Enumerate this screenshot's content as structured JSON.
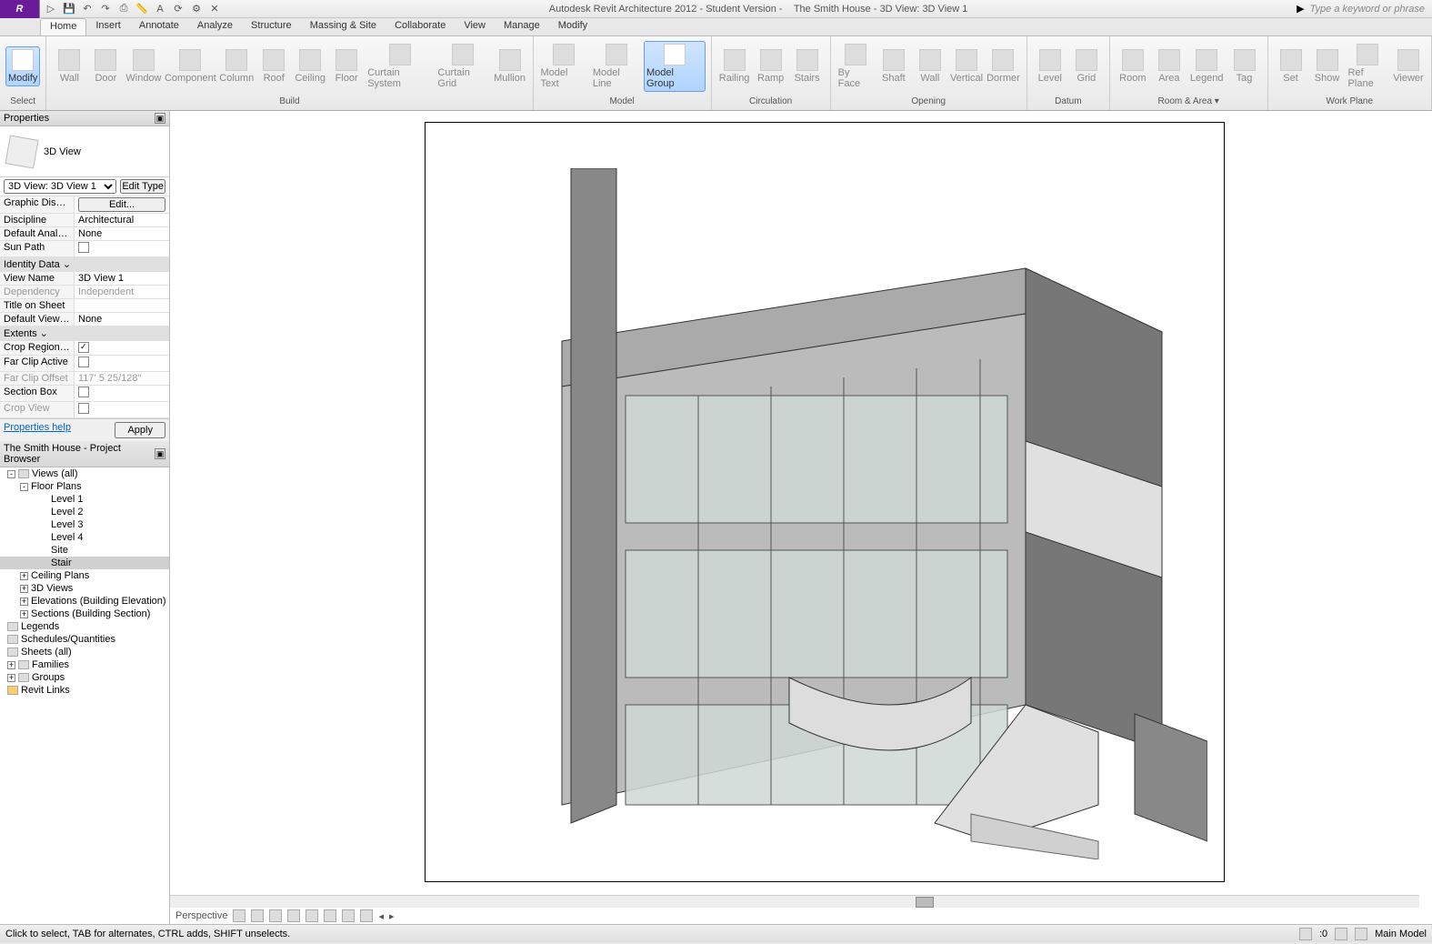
{
  "title": {
    "app": "Autodesk Revit Architecture 2012 - Student Version -",
    "doc": "The Smith House - 3D View: 3D View 1",
    "search_placeholder": "Type a keyword or phrase",
    "app_letter": "R"
  },
  "tabs": [
    "Home",
    "Insert",
    "Annotate",
    "Analyze",
    "Structure",
    "Massing & Site",
    "Collaborate",
    "View",
    "Manage",
    "Modify"
  ],
  "active_tab": "Home",
  "ribbon": {
    "groups": [
      {
        "label": "Select",
        "items": [
          {
            "name": "Modify",
            "active": true
          }
        ]
      },
      {
        "label": "Build",
        "items": [
          {
            "name": "Wall"
          },
          {
            "name": "Door"
          },
          {
            "name": "Window"
          },
          {
            "name": "Component"
          },
          {
            "name": "Column"
          },
          {
            "name": "Roof"
          },
          {
            "name": "Ceiling"
          },
          {
            "name": "Floor"
          },
          {
            "name": "Curtain System"
          },
          {
            "name": "Curtain Grid"
          },
          {
            "name": "Mullion"
          }
        ]
      },
      {
        "label": "Model",
        "items": [
          {
            "name": "Model Text"
          },
          {
            "name": "Model Line"
          },
          {
            "name": "Model Group",
            "active": true
          }
        ]
      },
      {
        "label": "Circulation",
        "items": [
          {
            "name": "Railing"
          },
          {
            "name": "Ramp"
          },
          {
            "name": "Stairs"
          }
        ]
      },
      {
        "label": "Opening",
        "items": [
          {
            "name": "By Face"
          },
          {
            "name": "Shaft"
          },
          {
            "name": "Wall"
          },
          {
            "name": "Vertical"
          },
          {
            "name": "Dormer"
          }
        ]
      },
      {
        "label": "Datum",
        "items": [
          {
            "name": "Level"
          },
          {
            "name": "Grid"
          }
        ]
      },
      {
        "label": "Room & Area ▾",
        "items": [
          {
            "name": "Room"
          },
          {
            "name": "Area"
          },
          {
            "name": "Legend"
          },
          {
            "name": "Tag"
          }
        ]
      },
      {
        "label": "Work Plane",
        "items": [
          {
            "name": "Set"
          },
          {
            "name": "Show"
          },
          {
            "name": "Ref Plane"
          },
          {
            "name": "Viewer"
          }
        ]
      }
    ]
  },
  "properties": {
    "panel_title": "Properties",
    "type_name": "3D View",
    "selector": "3D View: 3D View 1",
    "edit_type": "Edit Type",
    "help": "Properties help",
    "apply": "Apply",
    "rows": [
      {
        "k": "Graphic Displ...",
        "v": "Edit...",
        "btn": true
      },
      {
        "k": "Discipline",
        "v": "Architectural"
      },
      {
        "k": "Default Analy...",
        "v": "None"
      },
      {
        "k": "Sun Path",
        "chk": false
      },
      {
        "cat": "Identity Data"
      },
      {
        "k": "View Name",
        "v": "3D View 1"
      },
      {
        "k": "Dependency",
        "v": "Independent",
        "dim": true
      },
      {
        "k": "Title on Sheet",
        "v": ""
      },
      {
        "k": "Default View ...",
        "v": "None"
      },
      {
        "cat": "Extents"
      },
      {
        "k": "Crop Region ...",
        "chk": true
      },
      {
        "k": "Far Clip Active",
        "chk": false
      },
      {
        "k": "Far Clip Offset",
        "v": "117'  5 25/128\"",
        "dim": true
      },
      {
        "k": "Section Box",
        "chk": false
      },
      {
        "k": "Crop View",
        "chk": false,
        "dim": true
      }
    ]
  },
  "browser": {
    "title": "The Smith House - Project Browser",
    "tree": [
      {
        "t": "Views (all)",
        "ind": 0,
        "exp": "-",
        "ico": true
      },
      {
        "t": "Floor Plans",
        "ind": 1,
        "exp": "-"
      },
      {
        "t": "Level 1",
        "ind": 3
      },
      {
        "t": "Level 2",
        "ind": 3
      },
      {
        "t": "Level 3",
        "ind": 3
      },
      {
        "t": "Level 4",
        "ind": 3
      },
      {
        "t": "Site",
        "ind": 3
      },
      {
        "t": "Stair",
        "ind": 3,
        "sel": true
      },
      {
        "t": "Ceiling Plans",
        "ind": 1,
        "exp": "+"
      },
      {
        "t": "3D Views",
        "ind": 1,
        "exp": "+"
      },
      {
        "t": "Elevations (Building Elevation)",
        "ind": 1,
        "exp": "+"
      },
      {
        "t": "Sections (Building Section)",
        "ind": 1,
        "exp": "+"
      },
      {
        "t": "Legends",
        "ind": 0,
        "ico": true
      },
      {
        "t": "Schedules/Quantities",
        "ind": 0,
        "ico": true
      },
      {
        "t": "Sheets (all)",
        "ind": 0,
        "ico": true
      },
      {
        "t": "Families",
        "ind": 0,
        "exp": "+",
        "ico": true
      },
      {
        "t": "Groups",
        "ind": 0,
        "exp": "+",
        "ico": true
      },
      {
        "t": "Revit Links",
        "ind": 0,
        "ico": true,
        "link": true
      }
    ]
  },
  "viewbar": {
    "label": "Perspective"
  },
  "statusbar": {
    "hint": "Click to select, TAB for alternates, CTRL adds, SHIFT unselects.",
    "zero": ":0",
    "model": "Main Model"
  }
}
